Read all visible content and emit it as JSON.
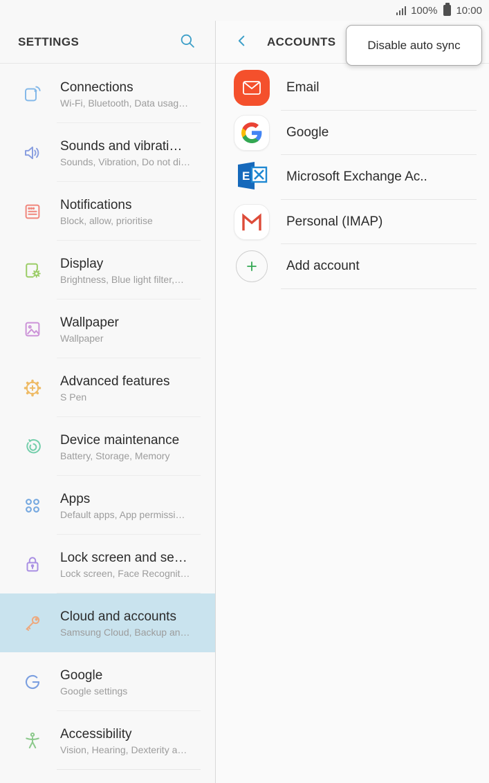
{
  "status_bar": {
    "battery_percent": "100%",
    "time": "10:00"
  },
  "colors": {
    "accent_blue": "#3d9fc8",
    "selected_row": "#c9e3ee",
    "email_brand": "#f4502c",
    "exchange_blue": "#1669bb",
    "gmail_red": "#dd4b39",
    "add_green": "#34a853"
  },
  "left_pane": {
    "title": "SETTINGS",
    "selected_color": "#c9e3ee",
    "items": [
      {
        "label": "Connections",
        "subtitle": "Wi-Fi, Bluetooth, Data usag…",
        "icon": "connections-icon",
        "color": "#85b9e9"
      },
      {
        "label": "Sounds and vibrati…",
        "subtitle": "Sounds, Vibration, Do not di…",
        "icon": "sound-icon",
        "color": "#8a9fe0"
      },
      {
        "label": "Notifications",
        "subtitle": "Block, allow, prioritise",
        "icon": "notifications-icon",
        "color": "#f0867c"
      },
      {
        "label": "Display",
        "subtitle": "Brightness, Blue light filter,…",
        "icon": "display-icon",
        "color": "#9acc65"
      },
      {
        "label": "Wallpaper",
        "subtitle": "Wallpaper",
        "icon": "wallpaper-icon",
        "color": "#cc93d8"
      },
      {
        "label": "Advanced features",
        "subtitle": "S Pen",
        "icon": "advanced-features-icon",
        "color": "#eebb66"
      },
      {
        "label": "Device maintenance",
        "subtitle": "Battery, Storage, Memory",
        "icon": "device-maintenance-icon",
        "color": "#74ceab"
      },
      {
        "label": "Apps",
        "subtitle": "Default apps, App permissi…",
        "icon": "apps-icon",
        "color": "#77a9e0"
      },
      {
        "label": "Lock screen and se…",
        "subtitle": "Lock screen, Face Recognit…",
        "icon": "lock-icon",
        "color": "#a98fe3"
      },
      {
        "label": "Cloud and accounts",
        "subtitle": "Samsung Cloud, Backup an…",
        "icon": "key-icon",
        "color": "#eda97e",
        "selected": true
      },
      {
        "label": "Google",
        "subtitle": "Google settings",
        "icon": "google-g-icon",
        "color": "#7b9fe0"
      },
      {
        "label": "Accessibility",
        "subtitle": "Vision, Hearing, Dexterity a…",
        "icon": "accessibility-icon",
        "color": "#8cc98c"
      }
    ]
  },
  "right_pane": {
    "title": "ACCOUNTS",
    "accounts": [
      {
        "label": "Email",
        "icon": "email-icon"
      },
      {
        "label": "Google",
        "icon": "google-icon"
      },
      {
        "label": "Microsoft Exchange Ac..",
        "icon": "exchange-icon"
      },
      {
        "label": "Personal (IMAP)",
        "icon": "gmail-icon"
      },
      {
        "label": "Add account",
        "icon": "add-account-icon"
      }
    ]
  },
  "popup": {
    "label": "Disable auto sync"
  }
}
